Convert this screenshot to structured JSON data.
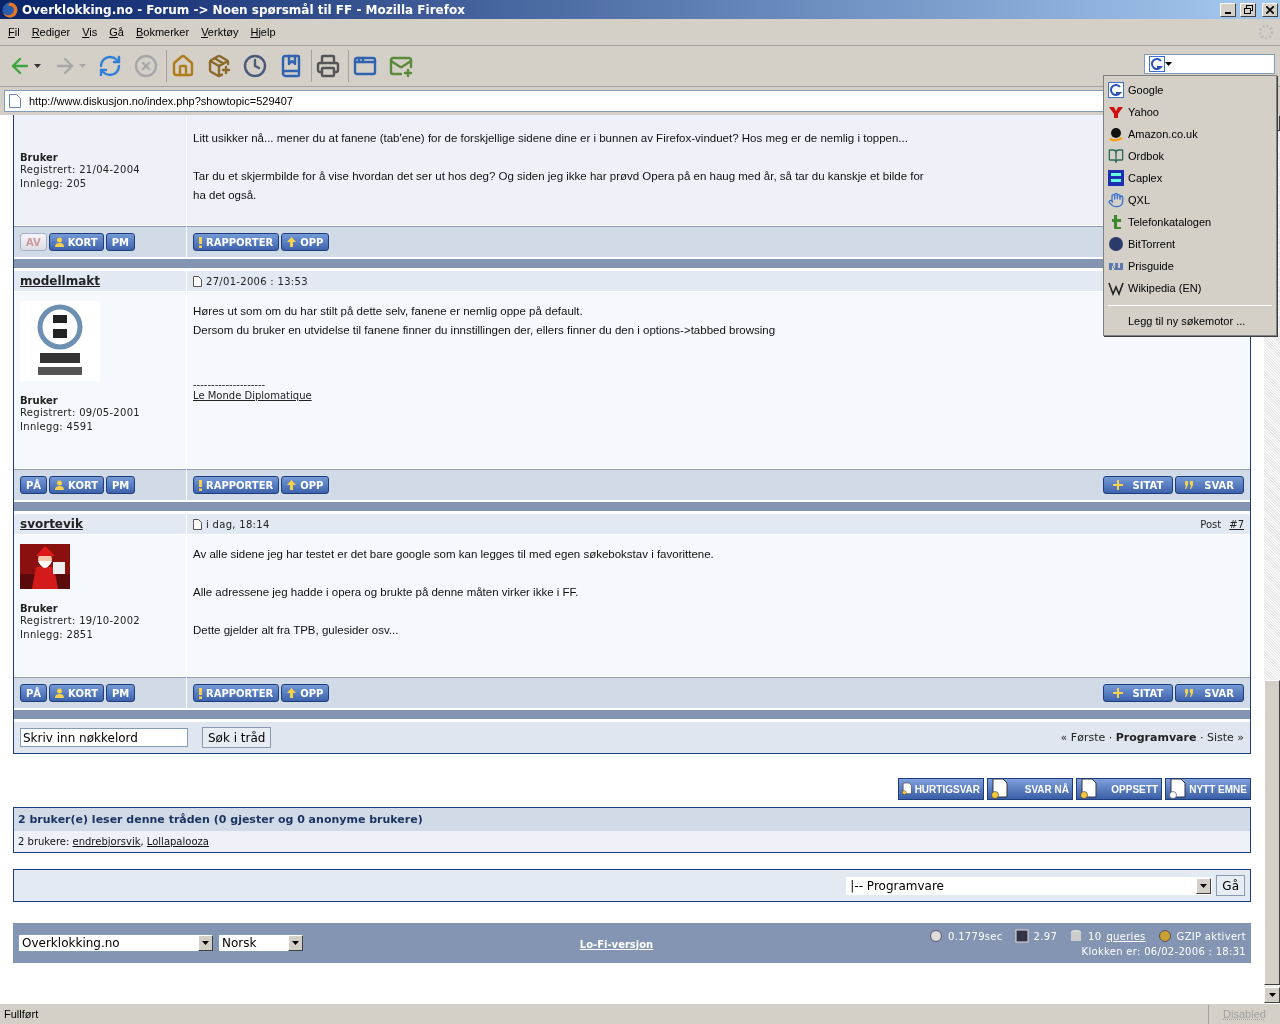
{
  "window": {
    "title": "Overklokking.no - Forum -> Noen spørsmål til FF - Mozilla Firefox"
  },
  "menu": [
    "Fil",
    "Rediger",
    "Vis",
    "Gå",
    "Bokmerker",
    "Verktøy",
    "Hjelp"
  ],
  "toolbar": [
    [
      {
        "kind": "back",
        "disabled": false,
        "has_menu": true
      },
      {
        "kind": "forward",
        "disabled": true,
        "has_menu": true
      },
      {
        "kind": "reload",
        "disabled": false,
        "has_menu": false
      },
      {
        "kind": "stop",
        "disabled": true,
        "has_menu": false
      }
    ],
    [
      {
        "kind": "home",
        "disabled": false,
        "has_menu": false
      },
      {
        "kind": "downloads",
        "disabled": false,
        "has_menu": false
      },
      {
        "kind": "history",
        "disabled": false,
        "has_menu": false
      },
      {
        "kind": "bookmarks",
        "disabled": false,
        "has_menu": false
      }
    ],
    [
      {
        "kind": "print",
        "disabled": false,
        "has_menu": false
      }
    ],
    [
      {
        "kind": "new_tab",
        "disabled": false,
        "has_menu": false
      },
      {
        "kind": "new_window",
        "disabled": false,
        "has_menu": false
      }
    ]
  ],
  "address": {
    "url": "http://www.diskusjon.no/index.php?showtopic=529407"
  },
  "search_engines": {
    "items": [
      {
        "name": "Google",
        "kind": "google"
      },
      {
        "name": "Yahoo",
        "kind": "yahoo"
      },
      {
        "name": "Amazon.co.uk",
        "kind": "amazon"
      },
      {
        "name": "Ordbok",
        "kind": "book"
      },
      {
        "name": "Caplex",
        "kind": "caplex"
      },
      {
        "name": "QXL",
        "kind": "hand"
      },
      {
        "name": "Telefonkatalogen",
        "kind": "phone"
      },
      {
        "name": "BitTorrent",
        "kind": "torrent"
      },
      {
        "name": "Prisguide",
        "kind": "prices"
      },
      {
        "name": "Wikipedia (EN)",
        "kind": "wiki"
      }
    ],
    "add_link": "Legg til ny søkemotor ..."
  },
  "posts": [
    {
      "group": "Bruker",
      "registered": "Registrert: 21/04-2004",
      "posts_count": "Innlegg: 205",
      "paragraphs": [
        [
          "Litt usikker nå... mener du at fanene (tab'ene) for de forskjellige sidene dine er i bunnen av Firefox-vinduet? Hos meg er de nemlig i toppen..."
        ],
        [
          "Tar du et skjermbilde for å vise hvordan det ser ut hos deg? Og siden jeg ikke har prøvd Opera på en haug med år, så tar du kanskje et bilde for",
          "ha det også."
        ]
      ],
      "online": false,
      "online_label": "AV",
      "left_buttons": [
        {
          "kind": "card",
          "label": "KORT"
        },
        {
          "kind": "pm",
          "label": "PM"
        }
      ],
      "right_buttons": [
        {
          "kind": "report",
          "label": "RAPPORTER"
        },
        {
          "kind": "up",
          "label": "OPP"
        }
      ]
    },
    {
      "author": "modellmakt",
      "date": "27/01-2006 : 13:53",
      "avatar": {
        "kind": "picture"
      },
      "group": "Bruker",
      "registered": "Registrert: 09/05-2001",
      "posts_count": "Innlegg: 4591",
      "paragraphs": [
        [
          "Høres ut som om du har stilt på dette selv, fanene er nemlig oppe på default.",
          "Dersom du bruker en utvidelse til fanene finner du innstillingen der, ellers finner du den i options->tabbed browsing"
        ]
      ],
      "signature": {
        "rule": "--------------------",
        "link": "Le Monde Diplomatique"
      },
      "online": true,
      "online_label": "PÅ",
      "left_buttons": [
        {
          "kind": "card",
          "label": "KORT"
        },
        {
          "kind": "pm",
          "label": "PM"
        }
      ],
      "right_buttons": [
        {
          "kind": "report",
          "label": "RAPPORTER"
        },
        {
          "kind": "up",
          "label": "OPP"
        }
      ],
      "reply_buttons": [
        {
          "kind": "quote",
          "label": "SITAT"
        },
        {
          "kind": "reply",
          "label": "SVAR"
        }
      ]
    },
    {
      "author": "svortevik",
      "date": "i dag, 18:14",
      "post_label": "Post",
      "post_number": "#7",
      "avatar": {
        "kind": "picture"
      },
      "group": "Bruker",
      "registered": "Registrert: 19/10-2002",
      "posts_count": "Innlegg: 2851",
      "paragraphs": [
        [
          "Av alle sidene jeg har testet er det bare google som kan legges til med egen søkebokstav i favorittene."
        ],
        [
          "Alle adressene jeg hadde i opera og brukte på denne måten virker ikke i FF."
        ],
        [
          "Dette gjelder alt fra TPB, gulesider osv..."
        ]
      ],
      "online": true,
      "online_label": "PÅ",
      "left_buttons": [
        {
          "kind": "card",
          "label": "KORT"
        },
        {
          "kind": "pm",
          "label": "PM"
        }
      ],
      "right_buttons": [
        {
          "kind": "report",
          "label": "RAPPORTER"
        },
        {
          "kind": "up",
          "label": "OPP"
        }
      ],
      "reply_buttons": [
        {
          "kind": "quote",
          "label": "SITAT"
        },
        {
          "kind": "reply",
          "label": "SVAR"
        }
      ]
    }
  ],
  "thread_search": {
    "value": "Skriv inn nøkkelord",
    "button": "Søk i tråd"
  },
  "pager": "« Første · **Programvare** · Siste »",
  "thread_buttons": [
    {
      "kind": "quick",
      "label": "HURTIGSVAR"
    },
    {
      "kind": "reply",
      "label": "SVAR NÅ"
    },
    {
      "kind": "options",
      "label": "OPPSETT"
    },
    {
      "kind": "new",
      "label": "NYTT EMNE"
    }
  ],
  "readers": {
    "title": "2 bruker(e) leser denne tråden (0 gjester og 0 anonyme brukere)",
    "label": "2 brukere:",
    "users": [
      {
        "name": "endrebjorsvik",
        "sep": ","
      },
      {
        "name": "Lollapalooza"
      }
    ]
  },
  "jump": {
    "value": "|-- Programvare",
    "button": "Gå"
  },
  "footer": {
    "skin": "Overklokking.no",
    "language": "Norsk",
    "lofi": "Lo-Fi-versjon",
    "stats": [
      {
        "kind": "time",
        "text": "0.1779sec"
      },
      {
        "kind": "load",
        "text": "2.97"
      },
      {
        "kind": "queries",
        "text": "10",
        "link": "queries"
      },
      {
        "kind": "gzip",
        "text": "GZIP aktivert"
      }
    ],
    "clock": "Klokken er: 06/02-2006 : 18:31"
  },
  "status_bar": {
    "text": "Fullført",
    "panel": "Disabled"
  }
}
